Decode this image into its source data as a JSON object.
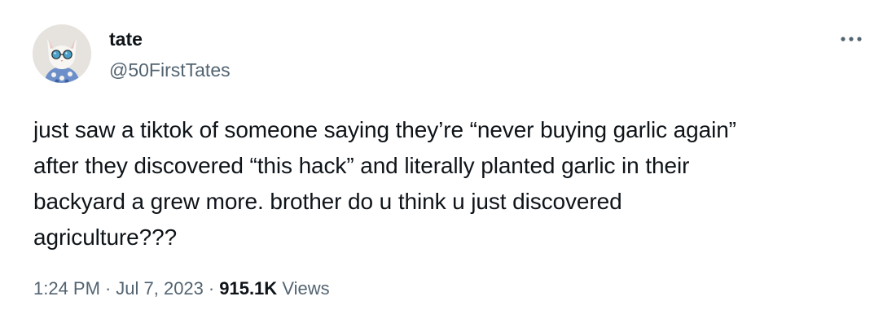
{
  "author": {
    "display_name": "tate",
    "handle": "@50FirstTates",
    "avatar_icon": "cat-with-sunglasses-avatar"
  },
  "more_icon": "more-horizontal-icon",
  "tweet": {
    "lines": [
      "just saw a tiktok of someone saying they’re “never buying garlic again”",
      "after they discovered “this hack” and literally planted garlic in their",
      "backyard a grew more. brother do u think u just discovered",
      "agriculture???"
    ]
  },
  "meta": {
    "time": "1:24 PM",
    "separator": "·",
    "date": "Jul 7, 2023",
    "views_count": "915.1K",
    "views_label": "Views"
  },
  "colors": {
    "primary_text": "#0f1419",
    "secondary_text": "#536471",
    "background": "#ffffff"
  }
}
